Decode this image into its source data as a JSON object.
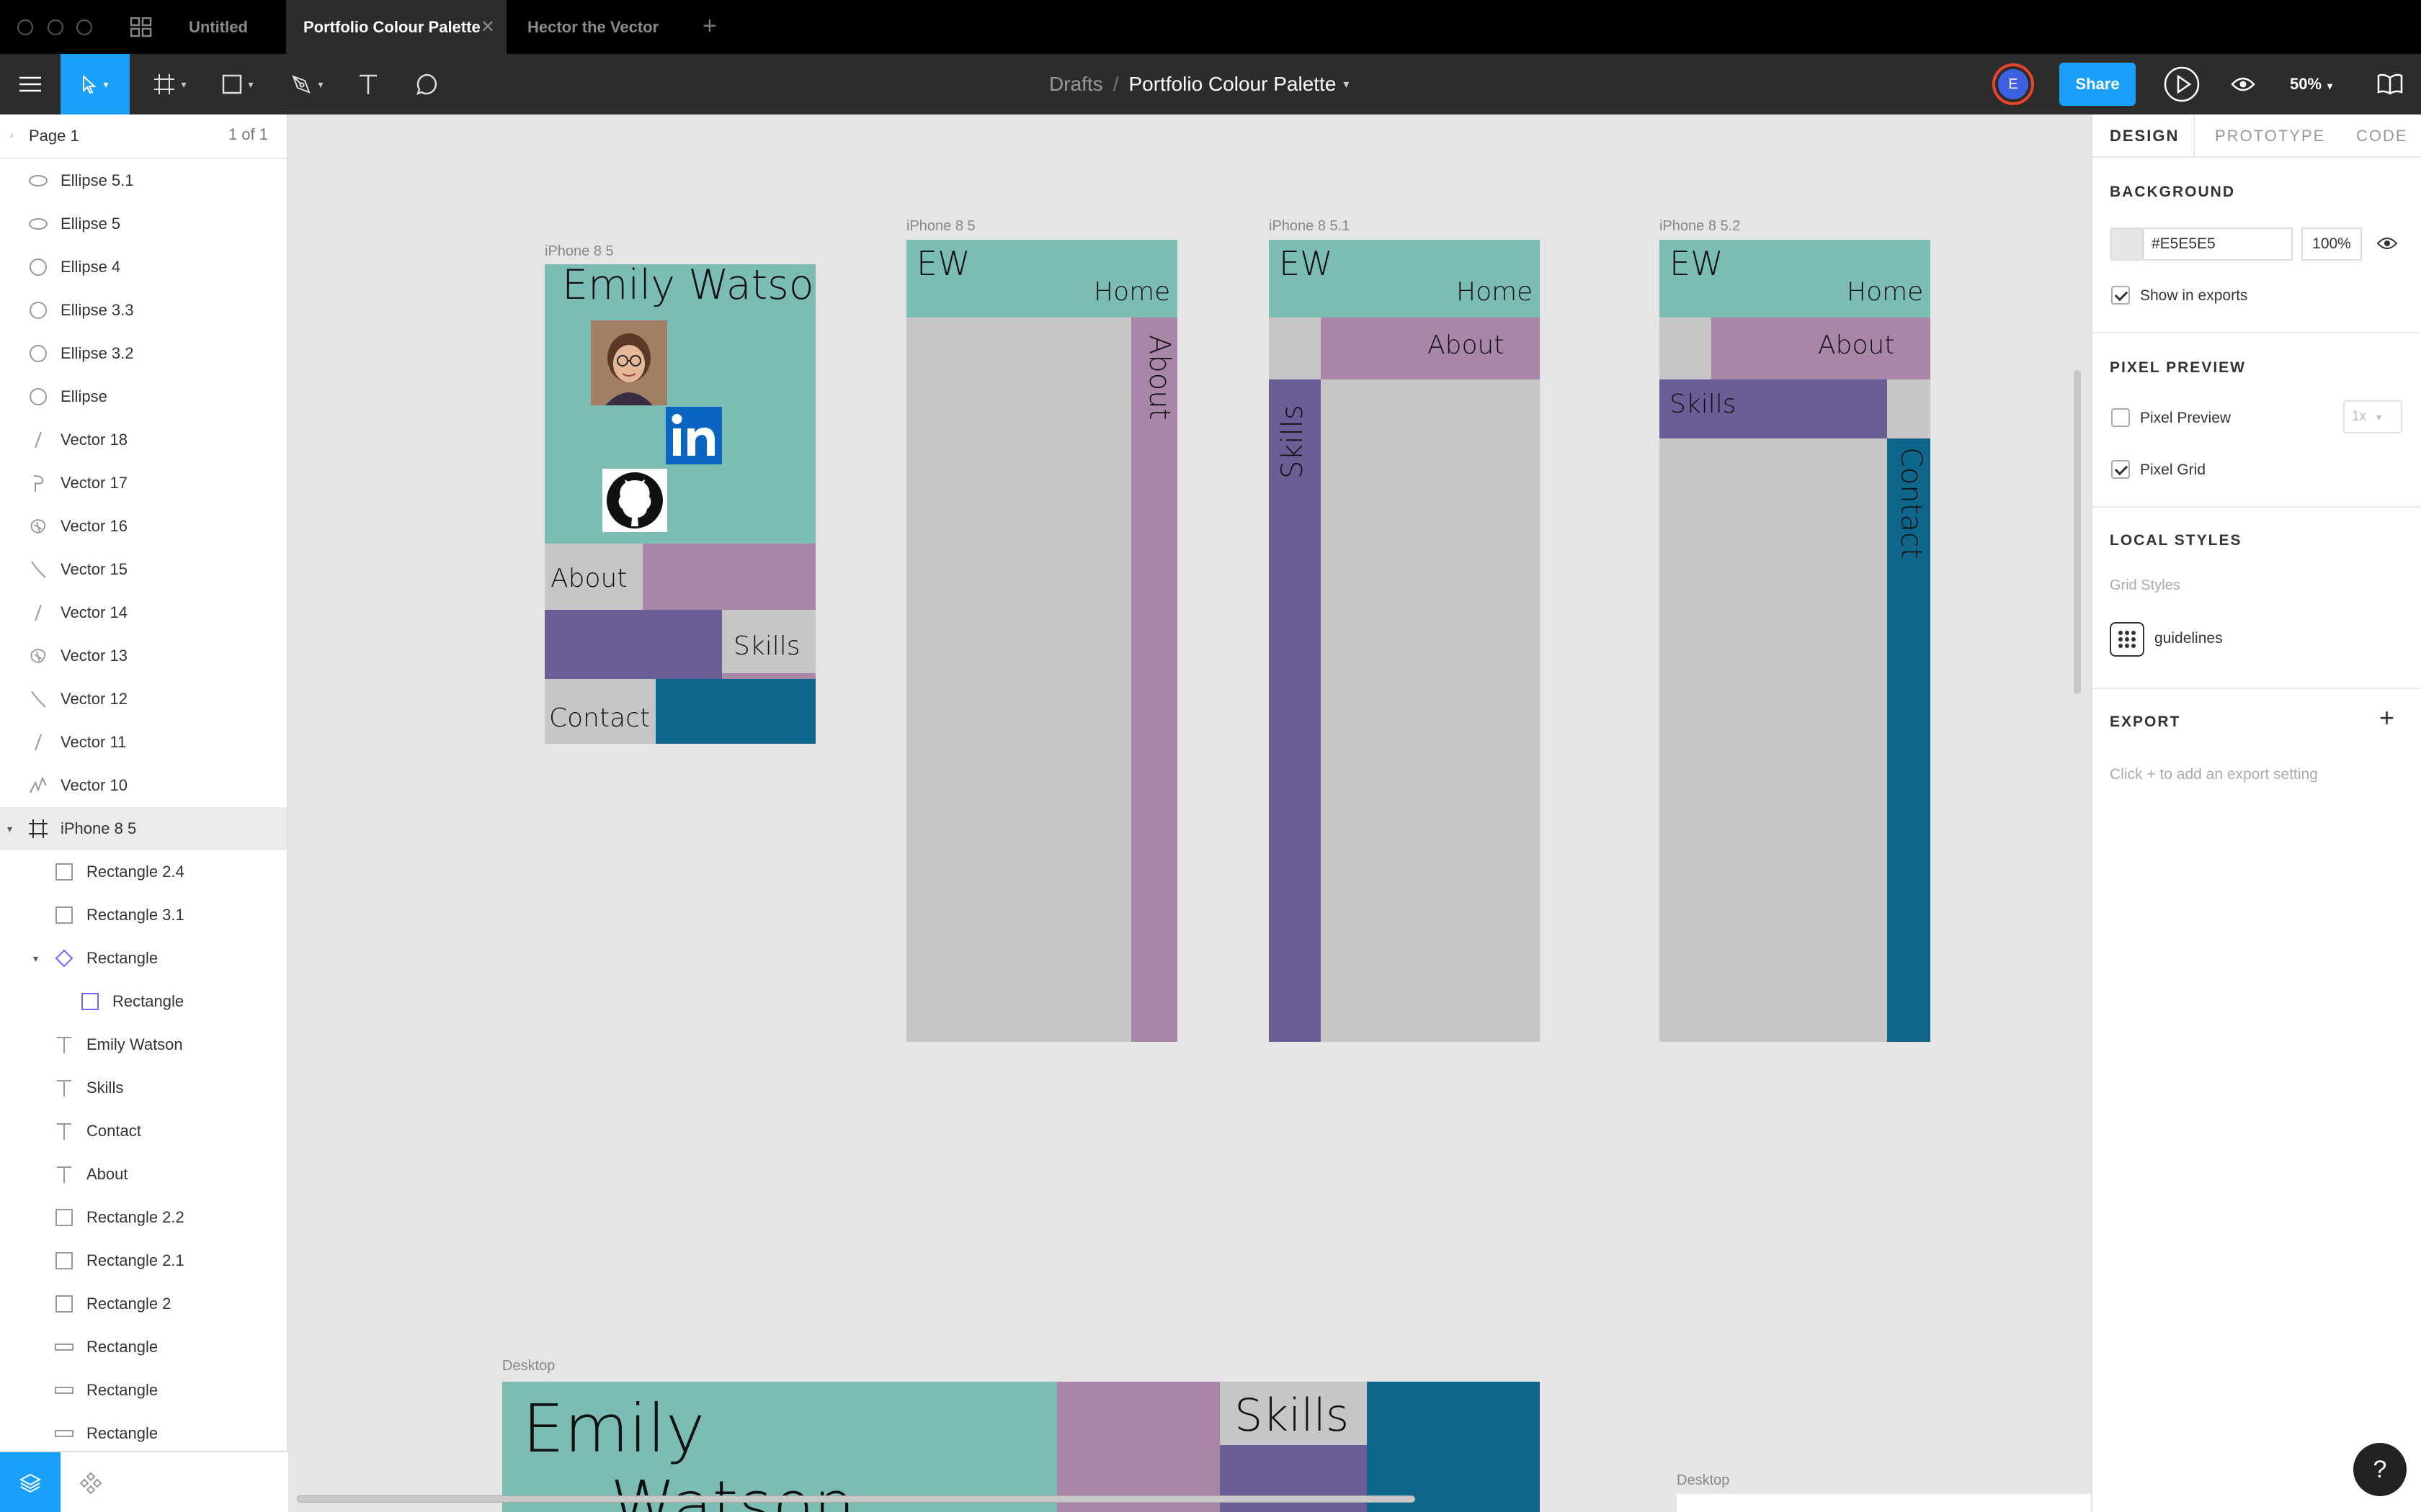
{
  "tabs": [
    {
      "label": "Untitled"
    },
    {
      "label": "Portfolio Colour Palette"
    },
    {
      "label": "Hector the Vector"
    }
  ],
  "tab_close": "✕",
  "tab_add": "+",
  "breadcrumb": {
    "parent": "Drafts",
    "separator": "/",
    "file": "Portfolio Colour Palette"
  },
  "avatar_initial": "E",
  "share_label": "Share",
  "zoom_label": "50%",
  "left_panel": {
    "page_label": "Page 1",
    "page_count": "1 of 1",
    "layers": [
      {
        "label": "Ellipse 5.1",
        "icon": "ellipse-icon"
      },
      {
        "label": "Ellipse 5",
        "icon": "ellipse-icon"
      },
      {
        "label": "Ellipse 4",
        "icon": "circle-icon"
      },
      {
        "label": "Ellipse 3.3",
        "icon": "circle-icon"
      },
      {
        "label": "Ellipse 3.2",
        "icon": "circle-icon"
      },
      {
        "label": "Ellipse",
        "icon": "circle-icon"
      },
      {
        "label": "Vector 18",
        "icon": "vector-line-icon"
      },
      {
        "label": "Vector 17",
        "icon": "vector-pin-icon"
      },
      {
        "label": "Vector 16",
        "icon": "vector-shape-icon"
      },
      {
        "label": "Vector 15",
        "icon": "vector-curve-icon"
      },
      {
        "label": "Vector 14",
        "icon": "vector-line-icon"
      },
      {
        "label": "Vector 13",
        "icon": "vector-shape-icon"
      },
      {
        "label": "Vector 12",
        "icon": "vector-curve-icon"
      },
      {
        "label": "Vector 11",
        "icon": "vector-line-icon"
      },
      {
        "label": "Vector 10",
        "icon": "vector-zigzag-icon"
      },
      {
        "label": "iPhone 8 5",
        "icon": "frame-icon"
      },
      {
        "label": "Rectangle 2.4",
        "icon": "rectangle-icon"
      },
      {
        "label": "Rectangle 3.1",
        "icon": "rectangle-icon"
      },
      {
        "label": "Rectangle",
        "icon": "component-icon"
      },
      {
        "label": "Rectangle",
        "icon": "rectangle-icon"
      },
      {
        "label": "Emily Watson",
        "icon": "text-icon"
      },
      {
        "label": "Skills",
        "icon": "text-icon"
      },
      {
        "label": "Contact",
        "icon": "text-icon"
      },
      {
        "label": "About",
        "icon": "text-icon"
      },
      {
        "label": "Rectangle 2.2",
        "icon": "rectangle-icon"
      },
      {
        "label": "Rectangle 2.1",
        "icon": "rectangle-icon"
      },
      {
        "label": "Rectangle 2",
        "icon": "rectangle-icon"
      },
      {
        "label": "Rectangle",
        "icon": "thin-rectangle-icon"
      },
      {
        "label": "Rectangle",
        "icon": "thin-rectangle-icon"
      },
      {
        "label": "Rectangle",
        "icon": "thin-rectangle-icon"
      }
    ]
  },
  "canvas": {
    "frames": [
      {
        "label": "iPhone 8 5"
      },
      {
        "label": "iPhone 8 5"
      },
      {
        "label": "iPhone 8 5.1"
      },
      {
        "label": "iPhone 8 5.2"
      },
      {
        "label": "Desktop"
      },
      {
        "label": "Desktop"
      }
    ],
    "mobile": {
      "name": "Emily Watson",
      "about": "About",
      "skills": "Skills",
      "contact": "Contact"
    },
    "variant": {
      "logo": "EW",
      "home": "Home",
      "about": "About",
      "skills": "Skills",
      "contact": "Contact"
    },
    "desktop": {
      "first": "Emily",
      "last": "Watson",
      "skills": "Skills"
    },
    "palette": {
      "teal": "#7bbcb5",
      "mauve": "#a985a8",
      "purple": "#6b5e96",
      "blue": "#0e668b",
      "grey": "#c6c6c6",
      "background": "#e5e5e5"
    }
  },
  "right_panel": {
    "tabs": [
      "DESIGN",
      "PROTOTYPE",
      "CODE"
    ],
    "background": {
      "title": "BACKGROUND",
      "hex": "#E5E5E5",
      "opacity": "100%",
      "show_in_exports": "Show in exports",
      "show_in_exports_checked": true
    },
    "pixel_preview": {
      "title": "PIXEL PREVIEW",
      "preview_label": "Pixel Preview",
      "preview_checked": false,
      "scale": "1x",
      "grid_label": "Pixel Grid",
      "grid_checked": true
    },
    "local_styles": {
      "title": "LOCAL STYLES",
      "subtitle": "Grid Styles",
      "style_name": "guidelines"
    },
    "export": {
      "title": "EXPORT",
      "add": "+",
      "hint": "Click + to add an export setting"
    }
  },
  "help_label": "?"
}
